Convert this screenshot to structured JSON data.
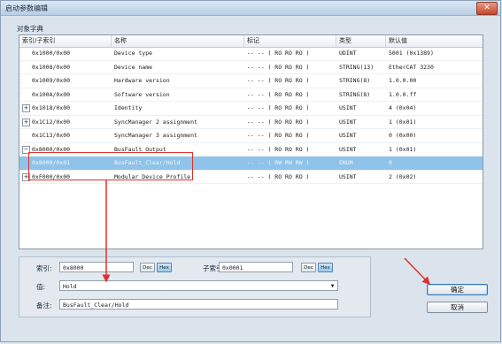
{
  "window": {
    "title": "启动参数编辑",
    "close_icon": "close-icon"
  },
  "group_label": "对象字典",
  "columns": [
    "索引/子索引",
    "名称",
    "标记",
    "类型",
    "默认值"
  ],
  "rows": [
    {
      "index": "0x1000/0x00",
      "name": "Device type",
      "flags": "-- -- ( RO RO RO )",
      "type": "UDINT",
      "default": "5001 (0x1389)",
      "toggle": ""
    },
    {
      "index": "0x1008/0x00",
      "name": "Device name",
      "flags": "-- -- ( RO RO RO )",
      "type": "STRING(13)",
      "default": "EtherCAT 3230",
      "toggle": ""
    },
    {
      "index": "0x1009/0x00",
      "name": "Hardware version",
      "flags": "-- -- ( RO RO RO )",
      "type": "STRING(8)",
      "default": "1.0.0.00",
      "toggle": ""
    },
    {
      "index": "0x100A/0x00",
      "name": "Software version",
      "flags": "-- -- ( RO RO RO )",
      "type": "STRING(8)",
      "default": "1.0.0.ff",
      "toggle": ""
    },
    {
      "index": "0x1018/0x00",
      "name": "Identity",
      "flags": "-- -- ( RO RO RO )",
      "type": "USINT",
      "default": "4 (0x04)",
      "toggle": "+"
    },
    {
      "index": "0x1C12/0x00",
      "name": "SyncManager 2 assignment",
      "flags": "-- -- ( RO RO RO )",
      "type": "USINT",
      "default": "1 (0x01)",
      "toggle": "+"
    },
    {
      "index": "0x1C13/0x00",
      "name": "SyncManager 3 assignment",
      "flags": "-- -- ( RO RO RO )",
      "type": "USINT",
      "default": "0 (0x00)",
      "toggle": ""
    },
    {
      "index": "0x8000/0x00",
      "name": "BusFault_Output",
      "flags": "-- -- ( RO RO RO )",
      "type": "USINT",
      "default": "1 (0x01)",
      "toggle": "−"
    },
    {
      "index": "0x8000/0x01",
      "name": "BusFault_Clear/Hold",
      "flags": "-- -- ( RW RW RW )",
      "type": "ENUM",
      "default": "0",
      "toggle": "",
      "selected": true
    },
    {
      "index": "0xF000/0x00",
      "name": "Modular Device Profile",
      "flags": "-- -- ( RO RO RO )",
      "type": "USINT",
      "default": "2 (0x02)",
      "toggle": "+"
    }
  ],
  "editor": {
    "index_label": "索引:",
    "index_value": "0x8000",
    "subindex_label": "子索引:",
    "subindex_value": "0x0001",
    "dec_label": "Dec",
    "hex_label": "Hex",
    "value_label": "值:",
    "value_selected": "Hold",
    "note_label": "备注:",
    "note_value": "BusFault_Clear/Hold"
  },
  "buttons": {
    "ok": "确定",
    "cancel": "取消"
  },
  "colors": {
    "selection": "#8fc3ea",
    "annotation": "#e0322a"
  }
}
